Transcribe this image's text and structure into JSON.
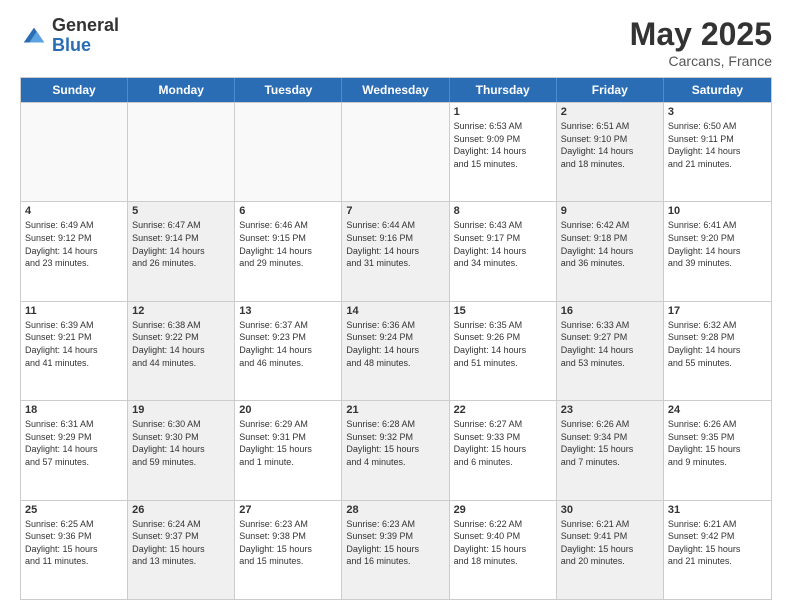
{
  "logo": {
    "general": "General",
    "blue": "Blue"
  },
  "title": {
    "month": "May 2025",
    "location": "Carcans, France"
  },
  "header": {
    "days": [
      "Sunday",
      "Monday",
      "Tuesday",
      "Wednesday",
      "Thursday",
      "Friday",
      "Saturday"
    ]
  },
  "weeks": [
    {
      "cells": [
        {
          "day": "",
          "info": "",
          "empty": true
        },
        {
          "day": "",
          "info": "",
          "empty": true
        },
        {
          "day": "",
          "info": "",
          "empty": true
        },
        {
          "day": "",
          "info": "",
          "empty": true
        },
        {
          "day": "1",
          "info": "Sunrise: 6:53 AM\nSunset: 9:09 PM\nDaylight: 14 hours\nand 15 minutes.",
          "shaded": false
        },
        {
          "day": "2",
          "info": "Sunrise: 6:51 AM\nSunset: 9:10 PM\nDaylight: 14 hours\nand 18 minutes.",
          "shaded": true
        },
        {
          "day": "3",
          "info": "Sunrise: 6:50 AM\nSunset: 9:11 PM\nDaylight: 14 hours\nand 21 minutes.",
          "shaded": false
        }
      ]
    },
    {
      "cells": [
        {
          "day": "4",
          "info": "Sunrise: 6:49 AM\nSunset: 9:12 PM\nDaylight: 14 hours\nand 23 minutes.",
          "shaded": false
        },
        {
          "day": "5",
          "info": "Sunrise: 6:47 AM\nSunset: 9:14 PM\nDaylight: 14 hours\nand 26 minutes.",
          "shaded": true
        },
        {
          "day": "6",
          "info": "Sunrise: 6:46 AM\nSunset: 9:15 PM\nDaylight: 14 hours\nand 29 minutes.",
          "shaded": false
        },
        {
          "day": "7",
          "info": "Sunrise: 6:44 AM\nSunset: 9:16 PM\nDaylight: 14 hours\nand 31 minutes.",
          "shaded": true
        },
        {
          "day": "8",
          "info": "Sunrise: 6:43 AM\nSunset: 9:17 PM\nDaylight: 14 hours\nand 34 minutes.",
          "shaded": false
        },
        {
          "day": "9",
          "info": "Sunrise: 6:42 AM\nSunset: 9:18 PM\nDaylight: 14 hours\nand 36 minutes.",
          "shaded": true
        },
        {
          "day": "10",
          "info": "Sunrise: 6:41 AM\nSunset: 9:20 PM\nDaylight: 14 hours\nand 39 minutes.",
          "shaded": false
        }
      ]
    },
    {
      "cells": [
        {
          "day": "11",
          "info": "Sunrise: 6:39 AM\nSunset: 9:21 PM\nDaylight: 14 hours\nand 41 minutes.",
          "shaded": false
        },
        {
          "day": "12",
          "info": "Sunrise: 6:38 AM\nSunset: 9:22 PM\nDaylight: 14 hours\nand 44 minutes.",
          "shaded": true
        },
        {
          "day": "13",
          "info": "Sunrise: 6:37 AM\nSunset: 9:23 PM\nDaylight: 14 hours\nand 46 minutes.",
          "shaded": false
        },
        {
          "day": "14",
          "info": "Sunrise: 6:36 AM\nSunset: 9:24 PM\nDaylight: 14 hours\nand 48 minutes.",
          "shaded": true
        },
        {
          "day": "15",
          "info": "Sunrise: 6:35 AM\nSunset: 9:26 PM\nDaylight: 14 hours\nand 51 minutes.",
          "shaded": false
        },
        {
          "day": "16",
          "info": "Sunrise: 6:33 AM\nSunset: 9:27 PM\nDaylight: 14 hours\nand 53 minutes.",
          "shaded": true
        },
        {
          "day": "17",
          "info": "Sunrise: 6:32 AM\nSunset: 9:28 PM\nDaylight: 14 hours\nand 55 minutes.",
          "shaded": false
        }
      ]
    },
    {
      "cells": [
        {
          "day": "18",
          "info": "Sunrise: 6:31 AM\nSunset: 9:29 PM\nDaylight: 14 hours\nand 57 minutes.",
          "shaded": false
        },
        {
          "day": "19",
          "info": "Sunrise: 6:30 AM\nSunset: 9:30 PM\nDaylight: 14 hours\nand 59 minutes.",
          "shaded": true
        },
        {
          "day": "20",
          "info": "Sunrise: 6:29 AM\nSunset: 9:31 PM\nDaylight: 15 hours\nand 1 minute.",
          "shaded": false
        },
        {
          "day": "21",
          "info": "Sunrise: 6:28 AM\nSunset: 9:32 PM\nDaylight: 15 hours\nand 4 minutes.",
          "shaded": true
        },
        {
          "day": "22",
          "info": "Sunrise: 6:27 AM\nSunset: 9:33 PM\nDaylight: 15 hours\nand 6 minutes.",
          "shaded": false
        },
        {
          "day": "23",
          "info": "Sunrise: 6:26 AM\nSunset: 9:34 PM\nDaylight: 15 hours\nand 7 minutes.",
          "shaded": true
        },
        {
          "day": "24",
          "info": "Sunrise: 6:26 AM\nSunset: 9:35 PM\nDaylight: 15 hours\nand 9 minutes.",
          "shaded": false
        }
      ]
    },
    {
      "cells": [
        {
          "day": "25",
          "info": "Sunrise: 6:25 AM\nSunset: 9:36 PM\nDaylight: 15 hours\nand 11 minutes.",
          "shaded": false
        },
        {
          "day": "26",
          "info": "Sunrise: 6:24 AM\nSunset: 9:37 PM\nDaylight: 15 hours\nand 13 minutes.",
          "shaded": true
        },
        {
          "day": "27",
          "info": "Sunrise: 6:23 AM\nSunset: 9:38 PM\nDaylight: 15 hours\nand 15 minutes.",
          "shaded": false
        },
        {
          "day": "28",
          "info": "Sunrise: 6:23 AM\nSunset: 9:39 PM\nDaylight: 15 hours\nand 16 minutes.",
          "shaded": true
        },
        {
          "day": "29",
          "info": "Sunrise: 6:22 AM\nSunset: 9:40 PM\nDaylight: 15 hours\nand 18 minutes.",
          "shaded": false
        },
        {
          "day": "30",
          "info": "Sunrise: 6:21 AM\nSunset: 9:41 PM\nDaylight: 15 hours\nand 20 minutes.",
          "shaded": true
        },
        {
          "day": "31",
          "info": "Sunrise: 6:21 AM\nSunset: 9:42 PM\nDaylight: 15 hours\nand 21 minutes.",
          "shaded": false
        }
      ]
    }
  ]
}
